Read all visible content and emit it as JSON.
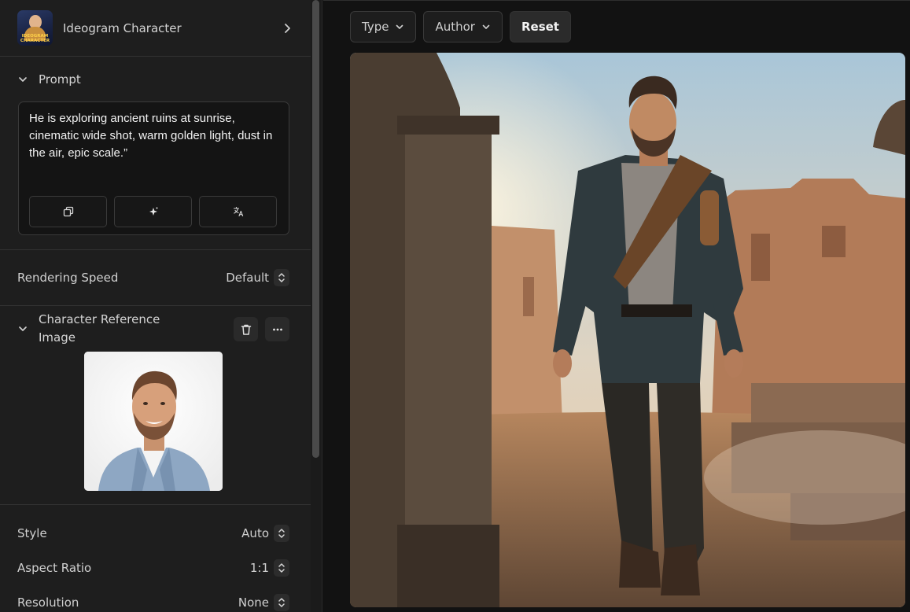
{
  "model": {
    "title": "Ideogram Character",
    "logo_text_line1": "IDEOGRAM",
    "logo_text_line2": "CHARACTER"
  },
  "prompt_section": {
    "title": "Prompt",
    "text": "He is exploring ancient ruins at sunrise, cinematic wide shot, warm golden light, dust in the air, epic scale.”",
    "actions": [
      "copy-icon",
      "sparkle-icon",
      "translate-icon"
    ]
  },
  "settings": {
    "rendering_speed": {
      "label": "Rendering Speed",
      "value": "Default"
    },
    "style": {
      "label": "Style",
      "value": "Auto"
    },
    "aspect_ratio": {
      "label": "Aspect Ratio",
      "value": "1:1"
    },
    "resolution": {
      "label": "Resolution",
      "value": "None"
    }
  },
  "character_reference": {
    "title": "Character Reference Image"
  },
  "filters": {
    "type_label": "Type",
    "author_label": "Author",
    "reset_label": "Reset"
  },
  "colors": {
    "panel_bg": "#1e1e1e",
    "app_bg": "#121212",
    "border": "#3a3a3a",
    "text_primary": "#f2f2f2"
  }
}
